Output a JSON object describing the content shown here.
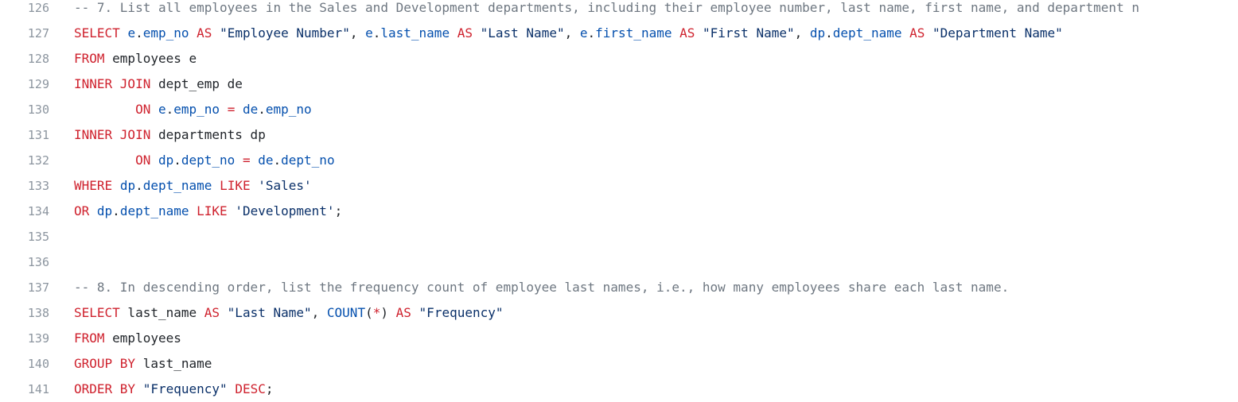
{
  "editor": {
    "colors": {
      "background": "#ffffff",
      "line_number": "#8c959f",
      "comment": "#6e7781",
      "keyword": "#cf222e",
      "string": "#0a3069",
      "identifier": "#0550ae",
      "plain": "#1f2328"
    },
    "lines": [
      {
        "number": "126",
        "tokens": [
          {
            "t": "-- 7. List all employees in the Sales and Development departments, including their employee number, last name, first name, and department n",
            "k": "comment"
          }
        ]
      },
      {
        "number": "127",
        "tokens": [
          {
            "t": "SELECT",
            "k": "keyword"
          },
          {
            "t": " ",
            "k": "plain"
          },
          {
            "t": "e",
            "k": "ident"
          },
          {
            "t": ".",
            "k": "plain"
          },
          {
            "t": "emp_no",
            "k": "ident"
          },
          {
            "t": " ",
            "k": "plain"
          },
          {
            "t": "AS",
            "k": "keyword"
          },
          {
            "t": " ",
            "k": "plain"
          },
          {
            "t": "\"Employee Number\"",
            "k": "string"
          },
          {
            "t": ", ",
            "k": "plain"
          },
          {
            "t": "e",
            "k": "ident"
          },
          {
            "t": ".",
            "k": "plain"
          },
          {
            "t": "last_name",
            "k": "ident"
          },
          {
            "t": " ",
            "k": "plain"
          },
          {
            "t": "AS",
            "k": "keyword"
          },
          {
            "t": " ",
            "k": "plain"
          },
          {
            "t": "\"Last Name\"",
            "k": "string"
          },
          {
            "t": ", ",
            "k": "plain"
          },
          {
            "t": "e",
            "k": "ident"
          },
          {
            "t": ".",
            "k": "plain"
          },
          {
            "t": "first_name",
            "k": "ident"
          },
          {
            "t": " ",
            "k": "plain"
          },
          {
            "t": "AS",
            "k": "keyword"
          },
          {
            "t": " ",
            "k": "plain"
          },
          {
            "t": "\"First Name\"",
            "k": "string"
          },
          {
            "t": ", ",
            "k": "plain"
          },
          {
            "t": "dp",
            "k": "ident"
          },
          {
            "t": ".",
            "k": "plain"
          },
          {
            "t": "dept_name",
            "k": "ident"
          },
          {
            "t": " ",
            "k": "plain"
          },
          {
            "t": "AS",
            "k": "keyword"
          },
          {
            "t": " ",
            "k": "plain"
          },
          {
            "t": "\"Department Name\"",
            "k": "string"
          }
        ]
      },
      {
        "number": "128",
        "tokens": [
          {
            "t": "FROM",
            "k": "keyword"
          },
          {
            "t": " employees e",
            "k": "plain"
          }
        ]
      },
      {
        "number": "129",
        "tokens": [
          {
            "t": "INNER JOIN",
            "k": "keyword"
          },
          {
            "t": " dept_emp de",
            "k": "plain"
          }
        ]
      },
      {
        "number": "130",
        "tokens": [
          {
            "t": "        ",
            "k": "plain"
          },
          {
            "t": "ON",
            "k": "keyword"
          },
          {
            "t": " ",
            "k": "plain"
          },
          {
            "t": "e",
            "k": "ident"
          },
          {
            "t": ".",
            "k": "plain"
          },
          {
            "t": "emp_no",
            "k": "ident"
          },
          {
            "t": " ",
            "k": "plain"
          },
          {
            "t": "=",
            "k": "keyword"
          },
          {
            "t": " ",
            "k": "plain"
          },
          {
            "t": "de",
            "k": "ident"
          },
          {
            "t": ".",
            "k": "plain"
          },
          {
            "t": "emp_no",
            "k": "ident"
          }
        ]
      },
      {
        "number": "131",
        "tokens": [
          {
            "t": "INNER JOIN",
            "k": "keyword"
          },
          {
            "t": " departments dp",
            "k": "plain"
          }
        ]
      },
      {
        "number": "132",
        "tokens": [
          {
            "t": "        ",
            "k": "plain"
          },
          {
            "t": "ON",
            "k": "keyword"
          },
          {
            "t": " ",
            "k": "plain"
          },
          {
            "t": "dp",
            "k": "ident"
          },
          {
            "t": ".",
            "k": "plain"
          },
          {
            "t": "dept_no",
            "k": "ident"
          },
          {
            "t": " ",
            "k": "plain"
          },
          {
            "t": "=",
            "k": "keyword"
          },
          {
            "t": " ",
            "k": "plain"
          },
          {
            "t": "de",
            "k": "ident"
          },
          {
            "t": ".",
            "k": "plain"
          },
          {
            "t": "dept_no",
            "k": "ident"
          }
        ]
      },
      {
        "number": "133",
        "tokens": [
          {
            "t": "WHERE",
            "k": "keyword"
          },
          {
            "t": " ",
            "k": "plain"
          },
          {
            "t": "dp",
            "k": "ident"
          },
          {
            "t": ".",
            "k": "plain"
          },
          {
            "t": "dept_name",
            "k": "ident"
          },
          {
            "t": " ",
            "k": "plain"
          },
          {
            "t": "LIKE",
            "k": "keyword"
          },
          {
            "t": " ",
            "k": "plain"
          },
          {
            "t": "'Sales'",
            "k": "string"
          }
        ]
      },
      {
        "number": "134",
        "tokens": [
          {
            "t": "OR",
            "k": "keyword"
          },
          {
            "t": " ",
            "k": "plain"
          },
          {
            "t": "dp",
            "k": "ident"
          },
          {
            "t": ".",
            "k": "plain"
          },
          {
            "t": "dept_name",
            "k": "ident"
          },
          {
            "t": " ",
            "k": "plain"
          },
          {
            "t": "LIKE",
            "k": "keyword"
          },
          {
            "t": " ",
            "k": "plain"
          },
          {
            "t": "'Development'",
            "k": "string"
          },
          {
            "t": ";",
            "k": "plain"
          }
        ]
      },
      {
        "number": "135",
        "tokens": []
      },
      {
        "number": "136",
        "tokens": []
      },
      {
        "number": "137",
        "tokens": [
          {
            "t": "-- 8. In descending order, list the frequency count of employee last names, i.e., how many employees share each last name.",
            "k": "comment"
          }
        ]
      },
      {
        "number": "138",
        "tokens": [
          {
            "t": "SELECT",
            "k": "keyword"
          },
          {
            "t": " last_name ",
            "k": "plain"
          },
          {
            "t": "AS",
            "k": "keyword"
          },
          {
            "t": " ",
            "k": "plain"
          },
          {
            "t": "\"Last Name\"",
            "k": "string"
          },
          {
            "t": ", ",
            "k": "plain"
          },
          {
            "t": "COUNT",
            "k": "ident"
          },
          {
            "t": "(",
            "k": "plain"
          },
          {
            "t": "*",
            "k": "keyword"
          },
          {
            "t": ")",
            "k": "plain"
          },
          {
            "t": " ",
            "k": "plain"
          },
          {
            "t": "AS",
            "k": "keyword"
          },
          {
            "t": " ",
            "k": "plain"
          },
          {
            "t": "\"Frequency\"",
            "k": "string"
          }
        ]
      },
      {
        "number": "139",
        "tokens": [
          {
            "t": "FROM",
            "k": "keyword"
          },
          {
            "t": " employees",
            "k": "plain"
          }
        ]
      },
      {
        "number": "140",
        "tokens": [
          {
            "t": "GROUP BY",
            "k": "keyword"
          },
          {
            "t": " last_name",
            "k": "plain"
          }
        ]
      },
      {
        "number": "141",
        "tokens": [
          {
            "t": "ORDER BY",
            "k": "keyword"
          },
          {
            "t": " ",
            "k": "plain"
          },
          {
            "t": "\"Frequency\"",
            "k": "string"
          },
          {
            "t": " ",
            "k": "plain"
          },
          {
            "t": "DESC",
            "k": "keyword"
          },
          {
            "t": ";",
            "k": "plain"
          }
        ]
      }
    ]
  }
}
